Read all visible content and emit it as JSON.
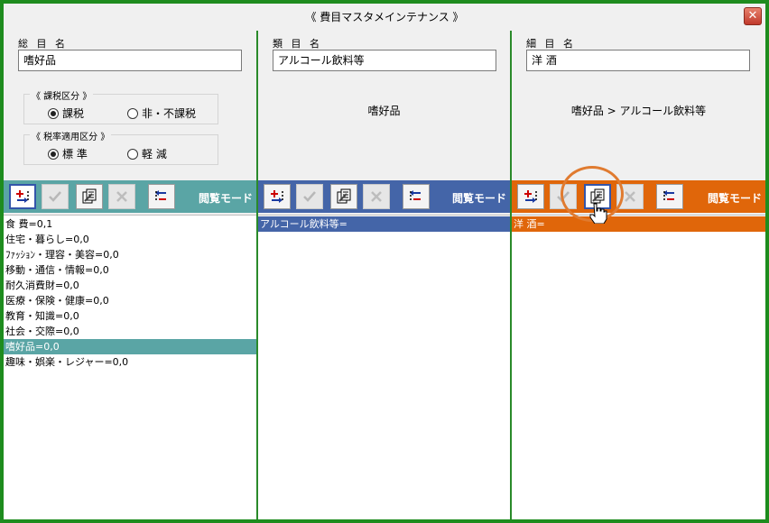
{
  "window": {
    "title": "《 費目マスタメインテナンス 》",
    "close_glyph": "✕"
  },
  "colors": {
    "panel1_accent": "#5aa5a5",
    "panel2_accent": "#4465a8",
    "panel3_accent": "#e0660a",
    "window_border": "#1e8c1e"
  },
  "panels": [
    {
      "label": "総 目 名",
      "value": "嗜好品",
      "path": "",
      "tax_group": {
        "title": "《 課税区分 》",
        "options": [
          "課税",
          "非・不課税"
        ],
        "selected": "課税"
      },
      "rate_group": {
        "title": "《 税率適用区分 》",
        "options": [
          "標 準",
          "軽 減"
        ],
        "selected": "標 準"
      },
      "mode": "閲覧モード",
      "items": [
        "食 費=0,1",
        "住宅・暮らし=0,0",
        "ﾌｧｯｼｮﾝ・理容・美容=0,0",
        "移動・通信・情報=0,0",
        "耐久消費財=0,0",
        "医療・保険・健康=0,0",
        "教育・知識=0,0",
        "社会・交際=0,0",
        "嗜好品=0,0",
        "趣味・娯楽・レジャー=0,0"
      ],
      "selected_index": 8
    },
    {
      "label": "類 目 名",
      "value": "アルコール飲料等",
      "path": "嗜好品",
      "mode": "閲覧モード",
      "items": [
        "アルコール飲料等="
      ],
      "selected_index": 0
    },
    {
      "label": "細 目 名",
      "value": "洋 酒",
      "path": "嗜好品 > アルコール飲料等",
      "mode": "閲覧モード",
      "items": [
        "洋 酒="
      ],
      "selected_index": 0
    }
  ],
  "toolbar_icons": [
    "add-icon",
    "confirm-check-icon",
    "copy-edit-icon",
    "delete-x-icon",
    "remove-icon"
  ]
}
